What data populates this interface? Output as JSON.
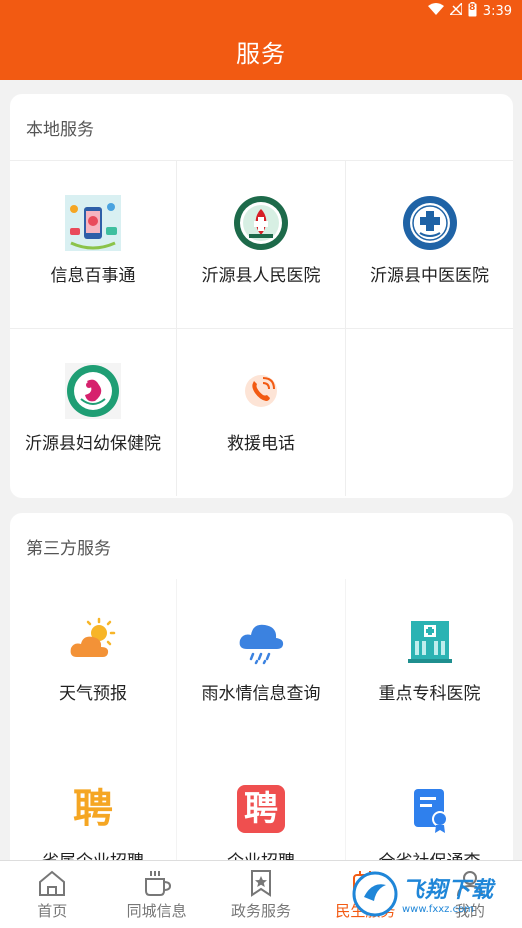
{
  "status_bar": {
    "time": "3:39",
    "battery": "8"
  },
  "header": {
    "title": "服务"
  },
  "local_services": {
    "title": "本地服务",
    "items": [
      {
        "label": "信息百事通",
        "icon": "info-service-icon"
      },
      {
        "label": "沂源县人民医院",
        "icon": "hospital-logo-icon"
      },
      {
        "label": "沂源县中医医院",
        "icon": "tcm-hospital-logo-icon"
      },
      {
        "label": "沂源县妇幼保健院",
        "icon": "maternal-hospital-logo-icon"
      },
      {
        "label": "救援电话",
        "icon": "phone-icon"
      }
    ]
  },
  "third_party_services": {
    "title": "第三方服务",
    "items": [
      {
        "label": "天气预报",
        "icon": "weather-icon"
      },
      {
        "label": "雨水情信息查询",
        "icon": "rain-cloud-icon"
      },
      {
        "label": "重点专科医院",
        "icon": "hospital-building-icon"
      },
      {
        "label": "省属企业招聘",
        "icon": "recruit-icon",
        "icon_text": "聘"
      },
      {
        "label": "企业招聘",
        "icon": "recruit-box-icon",
        "icon_text": "聘"
      },
      {
        "label": "全省社保通查",
        "icon": "social-security-icon"
      }
    ]
  },
  "tabbar": {
    "tabs": [
      {
        "label": "首页",
        "icon": "home-icon"
      },
      {
        "label": "同城信息",
        "icon": "coffee-cup-icon"
      },
      {
        "label": "政务服务",
        "icon": "bookmark-star-icon"
      },
      {
        "label": "民生服务",
        "icon": "service-icon",
        "active": true
      },
      {
        "label": "我的",
        "icon": "user-icon"
      }
    ]
  },
  "watermark": {
    "text": "飞翔下载",
    "url": "www.fxxz.com"
  },
  "colors": {
    "brand": "#f25a12",
    "background": "#f2f2f2",
    "card": "#ffffff",
    "active_tab": "#f25a12"
  }
}
